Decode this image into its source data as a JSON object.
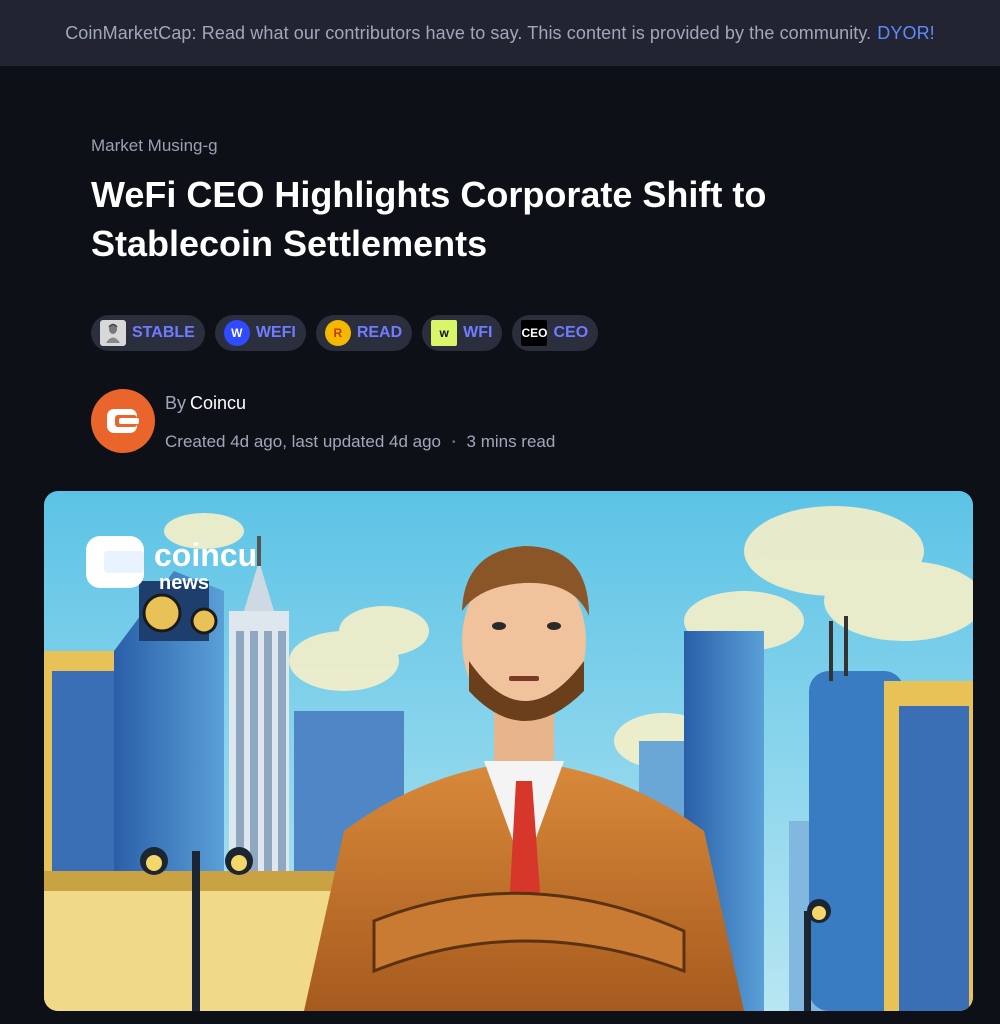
{
  "banner": {
    "text": "CoinMarketCap: Read what our contributors have to say. This content is provided by the community.",
    "link": "DYOR!"
  },
  "article": {
    "category": "Market Musing-g",
    "title": "WeFi CEO Highlights Corporate Shift to Stablecoin Settlements",
    "tags": [
      {
        "label": "STABLE",
        "icon": "stable-token-icon"
      },
      {
        "label": "WEFI",
        "icon": "wefi-token-icon",
        "glyph": "W"
      },
      {
        "label": "READ",
        "icon": "read-token-icon",
        "glyph": "R"
      },
      {
        "label": "WFI",
        "icon": "wfi-token-icon",
        "glyph": "w"
      },
      {
        "label": "CEO",
        "icon": "ceo-token-icon",
        "glyph": "CEO"
      }
    ],
    "author": {
      "by": "By",
      "name": "Coincu",
      "created": "Created 4d ago, last updated 4d ago",
      "dot": "•",
      "read_time": "3 mins read"
    },
    "hero": {
      "watermark_brand": "coincu",
      "watermark_sub": "news"
    }
  },
  "colors": {
    "background": "#0d1117",
    "banner": "#222531",
    "accent": "#6f7cff",
    "avatar": "#e9652b"
  }
}
